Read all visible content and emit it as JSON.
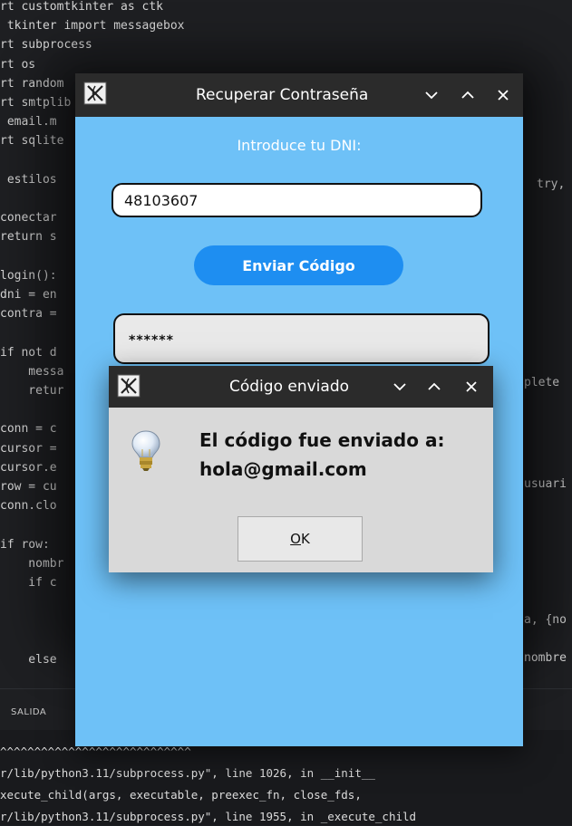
{
  "editor": {
    "code_lines": [
      "rt customtkinter as ctk",
      " tkinter import messagebox",
      "rt subprocess",
      "rt os",
      "rt random",
      "rt smtplib",
      " email.m",
      "rt sqlite",
      "",
      " estilos",
      "",
      "conectar",
      "return s",
      "",
      "login():",
      "dni = en",
      "contra =",
      "",
      "if not d",
      "    messa",
      "    retur",
      "",
      "conn = c",
      "cursor =",
      "cursor.e",
      "row = cu",
      "conn.clo",
      "",
      "if row:",
      "    nombr",
      "    if c",
      "",
      "",
      "",
      "    else"
    ],
    "right_snippets": [
      "try, c",
      "plete",
      "usuari",
      "a, {no",
      "nombre"
    ]
  },
  "panel": {
    "tab_label": "SALIDA"
  },
  "terminal": {
    "lines": [
      "^^^^^^^^^^^^^^^^^^^^^^^^^^^^",
      "r/lib/python3.11/subprocess.py\", line 1026, in __init__",
      "xecute_child(args, executable, preexec_fn, close_fds,",
      "r/lib/python3.11/subprocess.py\", line 1955, in _execute_child"
    ]
  },
  "recover_window": {
    "title": "Recuperar Contraseña",
    "dni_label": "Introduce tu DNI:",
    "dni_value": "48103607",
    "send_button_label": "Enviar Código",
    "password_mask": "******",
    "controls": [
      "chevron-down-icon",
      "chevron-up-icon",
      "close-icon"
    ]
  },
  "message_dialog": {
    "title": "Código enviado",
    "message_line1": "El código fue enviado a:",
    "message_line2": "hola@gmail.com",
    "ok_label_underlined": "O",
    "ok_label_rest": "K",
    "icon": "lightbulb-icon"
  },
  "colors": {
    "window_bg": "#6ec1f7",
    "button_blue": "#1e8ef1",
    "titlebar": "#2b2b2b",
    "dialog_bg": "#d9d9d9"
  }
}
